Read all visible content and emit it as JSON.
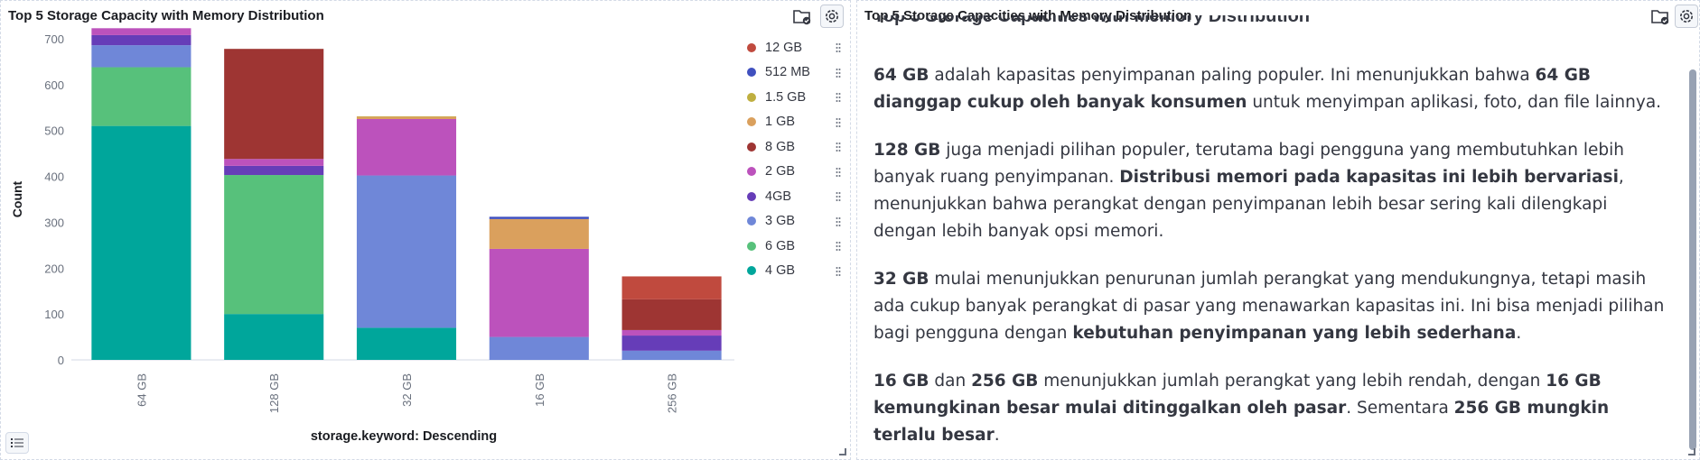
{
  "left_panel": {
    "title": "Top 5 Storage Capacity with Memory Distribution",
    "icons": [
      "folder-check-icon",
      "gear-icon",
      "list-icon"
    ]
  },
  "right_panel": {
    "title": "Top 5 Storage Capacities with Memory Distribution",
    "icons": [
      "folder-check-icon",
      "gear-icon"
    ],
    "ghost_heading": "Top 5 Storage Capacities with Memory Distribution",
    "paragraphs": [
      [
        {
          "t": "64 GB",
          "b": true
        },
        {
          "t": " adalah kapasitas penyimpanan paling populer. Ini menunjukkan bahwa ",
          "b": false
        },
        {
          "t": "64 GB dianggap cukup oleh banyak konsumen",
          "b": true
        },
        {
          "t": " untuk menyimpan aplikasi, foto, dan file lainnya.",
          "b": false
        }
      ],
      [
        {
          "t": "128 GB",
          "b": true
        },
        {
          "t": " juga menjadi pilihan populer, terutama bagi pengguna yang membutuhkan lebih banyak ruang penyimpanan. ",
          "b": false
        },
        {
          "t": "Distribusi memori pada kapasitas ini lebih bervariasi",
          "b": true
        },
        {
          "t": ", menunjukkan bahwa perangkat dengan penyimpanan lebih besar sering kali dilengkapi dengan lebih banyak opsi memori.",
          "b": false
        }
      ],
      [
        {
          "t": "32 GB",
          "b": true
        },
        {
          "t": " mulai menunjukkan penurunan jumlah perangkat yang mendukungnya, tetapi masih ada cukup banyak perangkat di pasar yang menawarkan kapasitas ini. Ini bisa menjadi pilihan bagi pengguna dengan ",
          "b": false
        },
        {
          "t": "kebutuhan penyimpanan yang lebih sederhana",
          "b": true
        },
        {
          "t": ".",
          "b": false
        }
      ],
      [
        {
          "t": "16 GB",
          "b": true
        },
        {
          "t": " dan ",
          "b": false
        },
        {
          "t": "256 GB",
          "b": true
        },
        {
          "t": " menunjukkan jumlah perangkat yang lebih rendah, dengan ",
          "b": false
        },
        {
          "t": "16 GB kemungkinan besar mulai ditinggalkan oleh pasar",
          "b": true
        },
        {
          "t": ". Sementara ",
          "b": false
        },
        {
          "t": "256 GB mungkin terlalu besar",
          "b": true
        },
        {
          "t": ".",
          "b": false
        }
      ]
    ]
  },
  "chart_data": {
    "type": "bar",
    "stacked": true,
    "title": "Top 5 Storage Capacity with Memory Distribution",
    "xlabel": "storage.keyword: Descending",
    "ylabel": "Count",
    "ylim": [
      0,
      700
    ],
    "yticks": [
      0,
      100,
      200,
      300,
      400,
      500,
      600,
      700
    ],
    "categories": [
      "64 GB",
      "128 GB",
      "32 GB",
      "16 GB",
      "256 GB"
    ],
    "series": [
      {
        "name": "4 GB",
        "color": "#00a69b",
        "values": [
          510,
          100,
          70,
          0,
          0
        ]
      },
      {
        "name": "6 GB",
        "color": "#57c17b",
        "values": [
          128,
          303,
          0,
          0,
          0
        ]
      },
      {
        "name": "3 GB",
        "color": "#6f87d8",
        "values": [
          48,
          0,
          332,
          50,
          20
        ]
      },
      {
        "name": "4GB",
        "color": "#663db8",
        "values": [
          22,
          20,
          0,
          0,
          33
        ]
      },
      {
        "name": "2 GB",
        "color": "#bc52bc",
        "values": [
          15,
          15,
          123,
          192,
          12
        ]
      },
      {
        "name": "8 GB",
        "color": "#9e3533",
        "values": [
          0,
          240,
          0,
          0,
          67
        ]
      },
      {
        "name": "1 GB",
        "color": "#daa05d",
        "values": [
          0,
          0,
          5,
          65,
          0
        ]
      },
      {
        "name": "1.5 GB",
        "color": "#bfaf40",
        "values": [
          0,
          0,
          1,
          0,
          0
        ]
      },
      {
        "name": "512 MB",
        "color": "#4050bf",
        "values": [
          0,
          0,
          0,
          5,
          0
        ]
      },
      {
        "name": "12 GB",
        "color": "#c04a3e",
        "values": [
          0,
          0,
          0,
          0,
          50
        ]
      }
    ],
    "legend": {
      "placement": "right",
      "order": [
        "12 GB",
        "512 MB",
        "1.5 GB",
        "1 GB",
        "8 GB",
        "2 GB",
        "4GB",
        "3 GB",
        "6 GB",
        "4 GB"
      ]
    },
    "grid": false
  }
}
